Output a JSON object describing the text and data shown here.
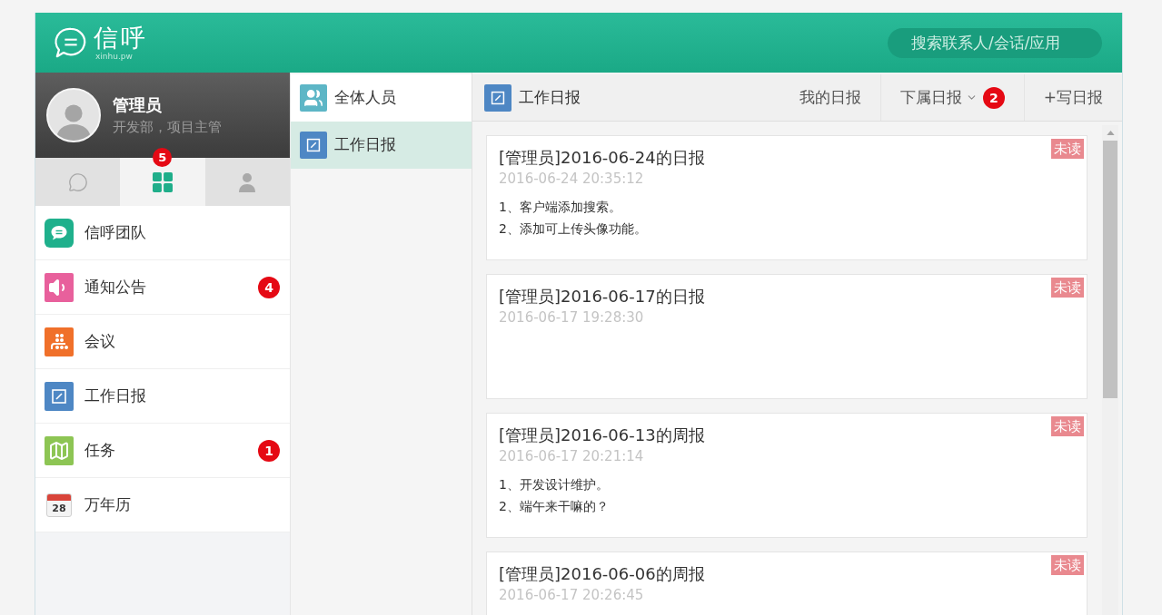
{
  "header": {
    "logo": {
      "title": "信呼",
      "subtitle": "xinhu.pw"
    },
    "search": {
      "placeholder": "搜索联系人/会话/应用"
    }
  },
  "profile": {
    "name": "管理员",
    "role": "开发部，项目主管"
  },
  "sidebar_tabs": [
    {
      "selected": false
    },
    {
      "selected": true,
      "badge": "5"
    },
    {
      "selected": false
    }
  ],
  "sidebar_items": [
    {
      "label": "信呼团队",
      "color": "#1fb08c"
    },
    {
      "label": "通知公告",
      "color": "#e8609c",
      "badge": "4"
    },
    {
      "label": "会议",
      "color": "#f0702a"
    },
    {
      "label": "工作日报",
      "color": "#4e87c4"
    },
    {
      "label": "任务",
      "color": "#8dc554",
      "badge": "1"
    },
    {
      "label": "万年历",
      "icon_text": "28"
    }
  ],
  "module_list": [
    {
      "label": "全体人员",
      "selected": false,
      "color": "#5db6c6"
    },
    {
      "label": "工作日报",
      "selected": true,
      "color": "#4e87c4"
    }
  ],
  "toolbar": {
    "title": "工作日报",
    "actions": [
      {
        "label": "我的日报",
        "kind": "link"
      },
      {
        "label": "下属日报",
        "kind": "dropdown",
        "badge": "2"
      },
      {
        "label": "+写日报",
        "kind": "link"
      }
    ]
  },
  "reports": [
    {
      "title": "[管理员]2016-06-24的日报",
      "time": "2016-06-24 20:35:12",
      "status": "未读",
      "lines": [
        "1、客户端添加搜索。",
        "2、添加可上传头像功能。"
      ]
    },
    {
      "title": "[管理员]2016-06-17的日报",
      "time": "2016-06-17 19:28:30",
      "status": "未读"
    },
    {
      "title": "[管理员]2016-06-13的周报",
      "time": "2016-06-17 20:21:14",
      "status": "未读",
      "lines": [
        "1、开发设计维护。",
        "2、端午来干嘛的？"
      ]
    },
    {
      "title": "[管理员]2016-06-06的周报",
      "time": "2016-06-17 20:26:45",
      "status": "未读"
    }
  ]
}
